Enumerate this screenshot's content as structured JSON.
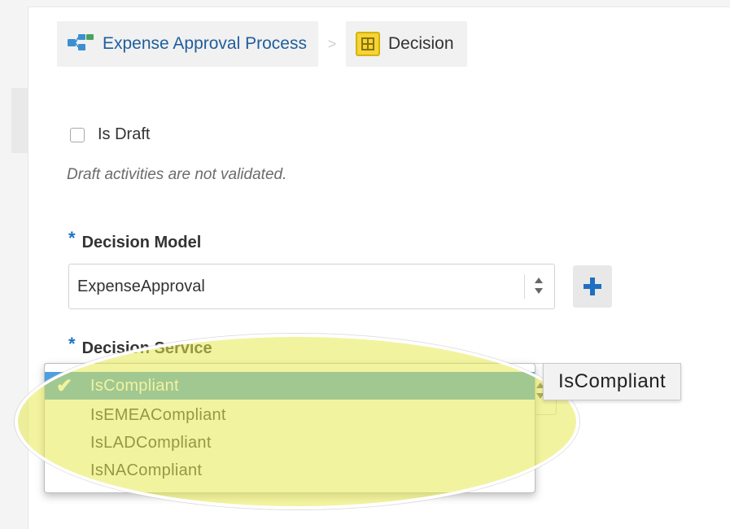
{
  "breadcrumb": {
    "process_label": "Expense Approval Process",
    "process_icon": "process-flow-icon",
    "separator": ">",
    "current_label": "Decision",
    "current_icon": "decision-table-icon"
  },
  "draft": {
    "checkbox_label": "Is Draft",
    "checked": false,
    "note": "Draft activities are not validated."
  },
  "decision_model": {
    "required_marker": "*",
    "label": "Decision Model",
    "value": "ExpenseApproval",
    "add_icon": "plus-icon"
  },
  "decision_service": {
    "required_marker": "*",
    "label": "Decision Service",
    "options": [
      "IsCompliant",
      "IsEMEACompliant",
      "IsLADCompliant",
      "IsNACompliant"
    ],
    "selected": "IsCompliant",
    "check_mark": "✔",
    "tooltip": "IsCompliant"
  },
  "colors": {
    "link": "#1f5e9c",
    "required": "#1c75c4",
    "selected_option": "#4d9fe0",
    "highlight": "#e8ea50",
    "decision_icon": "#f5d33a"
  }
}
